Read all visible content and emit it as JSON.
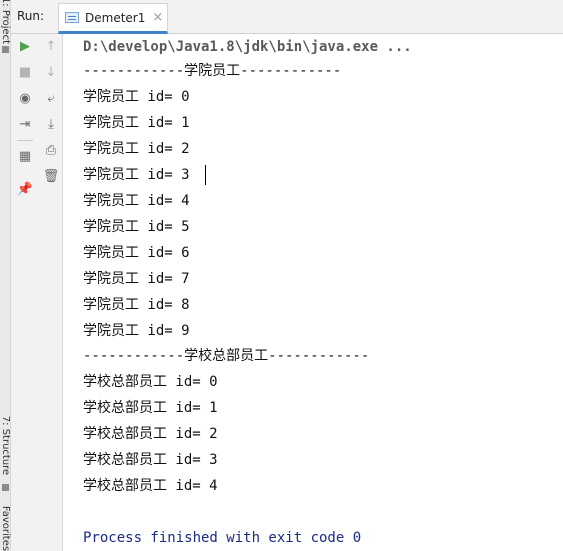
{
  "side_strip": {
    "top_tab": "1: Project",
    "structure_tab": "7: Structure",
    "favorites_tab": "Favorites"
  },
  "header": {
    "run_label": "Run:",
    "tab_title": "Demeter1",
    "tab_close": "×"
  },
  "toolbar": {
    "rerun_icon": "▶",
    "up_icon": "↑",
    "stop_icon": "■",
    "down_icon": "↓",
    "camera_icon": "◉",
    "wrap_icon": "⤶",
    "login_icon": "⇥",
    "scroll_end_icon": "⤓",
    "layout_icon": "▦",
    "print_icon": "⎙",
    "trash_icon": "🗑",
    "pin_icon": "📌",
    "colors": {
      "run": "#4fa04b",
      "disabled": "#b4b4b4",
      "normal": "#6a6a6a"
    }
  },
  "console": {
    "command": "D:\\develop\\Java1.8\\jdk\\bin\\java.exe ...",
    "college_header": "------------学院员工------------",
    "college_lines": [
      "学院员工 id= 0",
      "学院员工 id= 1",
      "学院员工 id= 2",
      "学院员工 id= 3",
      "学院员工 id= 4",
      "学院员工 id= 5",
      "学院员工 id= 6",
      "学院员工 id= 7",
      "学院员工 id= 8",
      "学院员工 id= 9"
    ],
    "school_header": "------------学校总部员工------------",
    "school_lines": [
      "学校总部员工 id= 0",
      "学校总部员工 id= 1",
      "学校总部员工 id= 2",
      "学校总部员工 id= 3",
      "学校总部员工 id= 4"
    ],
    "exit_message": "Process finished with exit code 0",
    "colors": {
      "text": "#111111",
      "command": "#5a5a5a",
      "exit": "#1b2b84"
    }
  }
}
